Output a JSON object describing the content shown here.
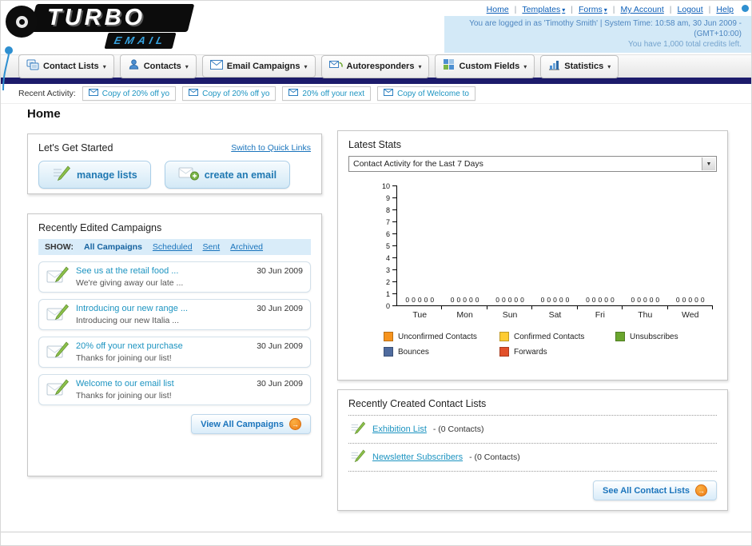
{
  "colors": {
    "navy_bar": "#1c1b6b",
    "orange_accent": "#ee7c17",
    "link_blue": "#1a74bc",
    "teal_link": "#1d94c1"
  },
  "header": {
    "logo_line1": "TURBO",
    "logo_line2": "EMAIL",
    "nav": [
      {
        "label": "Home"
      },
      {
        "label": "Templates"
      },
      {
        "label": "Forms"
      },
      {
        "label": "My Account"
      },
      {
        "label": "Logout"
      },
      {
        "label": "Help"
      }
    ],
    "login_line": "You are logged in as 'Timothy Smith' | System Time: 10:58 am, 30 Jun 2009 - (GMT+10:00)",
    "credits_line": "You have 1,000 total credits left."
  },
  "nav_tabs": [
    {
      "label": "Contact Lists"
    },
    {
      "label": "Contacts"
    },
    {
      "label": "Email Campaigns"
    },
    {
      "label": "Autoresponders"
    },
    {
      "label": "Custom Fields"
    },
    {
      "label": "Statistics"
    }
  ],
  "recent_activity": {
    "label": "Recent Activity:",
    "items": [
      "Copy of 20% off yo",
      "Copy of 20% off yo",
      "20% off your next",
      "Copy of Welcome to"
    ]
  },
  "page_title": "Home",
  "get_started": {
    "title": "Let's Get Started",
    "switch_link": "Switch to Quick Links",
    "manage_lists_label": "manage lists",
    "create_email_label": "create an email"
  },
  "campaigns": {
    "title": "Recently Edited Campaigns",
    "show_label": "SHOW:",
    "filters": [
      "All Campaigns",
      "Scheduled",
      "Sent",
      "Archived"
    ],
    "active_filter": "All Campaigns",
    "items": [
      {
        "title": "See us at the retail food ...",
        "subtitle": "We're giving away our late ...",
        "date": "30 Jun 2009"
      },
      {
        "title": "Introducing our new range ...",
        "subtitle": "Introducing our new Italia ...",
        "date": "30 Jun 2009"
      },
      {
        "title": "20% off your next purchase",
        "subtitle": "Thanks for joining our list!",
        "date": "30 Jun 2009"
      },
      {
        "title": "Welcome to our email list",
        "subtitle": "Thanks for joining our list!",
        "date": "30 Jun 2009"
      }
    ],
    "view_all_label": "View All Campaigns"
  },
  "latest_stats": {
    "title": "Latest Stats",
    "dropdown_value": "Contact Activity for the Last 7 Days"
  },
  "chart_data": {
    "type": "bar",
    "title": "Contact Activity for the Last 7 Days",
    "categories": [
      "Tue",
      "Mon",
      "Sun",
      "Sat",
      "Fri",
      "Thu",
      "Wed"
    ],
    "series": [
      {
        "name": "Unconfirmed Contacts",
        "color": "#f7941e",
        "values": [
          0,
          0,
          0,
          0,
          0,
          0,
          0
        ]
      },
      {
        "name": "Confirmed Contacts",
        "color": "#ffcc33",
        "values": [
          0,
          0,
          0,
          0,
          0,
          0,
          0
        ]
      },
      {
        "name": "Unsubscribes",
        "color": "#6aa62e",
        "values": [
          0,
          0,
          0,
          0,
          0,
          0,
          0
        ]
      },
      {
        "name": "Bounces",
        "color": "#4f6b9e",
        "values": [
          0,
          0,
          0,
          0,
          0,
          0,
          0
        ]
      },
      {
        "name": "Forwards",
        "color": "#e2502a",
        "values": [
          0,
          0,
          0,
          0,
          0,
          0,
          0
        ]
      }
    ],
    "ylim": [
      0,
      10
    ],
    "yticks": [
      0,
      1,
      2,
      3,
      4,
      5,
      6,
      7,
      8,
      9,
      10
    ],
    "grid": false,
    "legend_position": "bottom"
  },
  "contact_lists": {
    "title": "Recently Created Contact Lists",
    "items": [
      {
        "name": "Exhibition List",
        "count": "- (0 Contacts)"
      },
      {
        "name": "Newsletter Subscribers",
        "count": "- (0 Contacts)"
      }
    ],
    "see_all_label": "See All Contact Lists"
  }
}
